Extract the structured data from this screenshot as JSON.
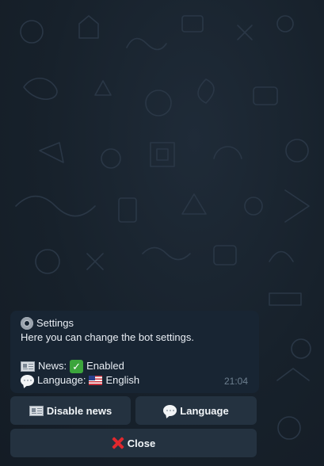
{
  "message": {
    "title_icon": "gear-icon",
    "title": "Settings",
    "description": "Here you can change the bot settings.",
    "news_label": "News:",
    "news_icon": "newspaper-icon",
    "news_status_icon": "check-mark-icon",
    "news_status": "Enabled",
    "language_label": "Language:",
    "language_icon": "speech-balloon-icon",
    "language_flag": "us-flag-icon",
    "language_value": "English",
    "time": "21:04"
  },
  "keyboard": {
    "disable_news_label": "Disable news",
    "disable_news_icon": "newspaper-icon",
    "language_label": "Language",
    "language_icon": "speech-balloon-icon",
    "close_label": "Close",
    "close_icon": "cross-mark-icon",
    "close_icon_color": "#e0282e"
  },
  "theme": {
    "background": "#17212b",
    "bubble": "#182533",
    "button": "#243240",
    "time_color": "#6d7f8f"
  }
}
